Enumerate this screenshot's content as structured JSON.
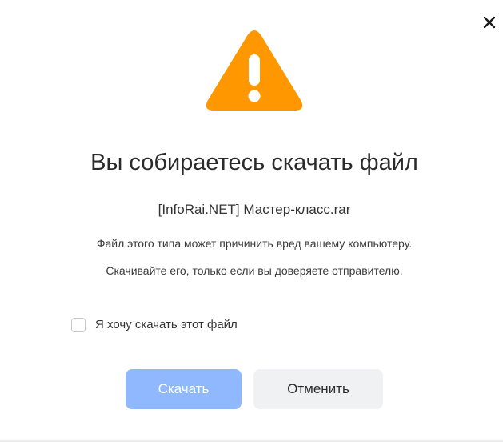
{
  "dialog": {
    "title": "Вы собираетесь скачать файл",
    "filename": "[InfoRai.NET] Мастер-класс.rar",
    "warning_line1": "Файл этого типа может причинить вред вашему компьютеру.",
    "warning_line2": "Скачивайте его, только если вы доверяете отправителю.",
    "consent_label": "Я хочу скачать этот файл",
    "consent_checked": false,
    "download_button": "Скачать",
    "cancel_button": "Отменить",
    "download_enabled": false
  },
  "icons": {
    "warning": "warning-triangle-icon",
    "close": "close-icon"
  },
  "colors": {
    "warning_orange": "#ff9800",
    "download_disabled": "#8fb8ff",
    "cancel_bg": "#f0f1f3",
    "text": "#2b2b2b"
  }
}
